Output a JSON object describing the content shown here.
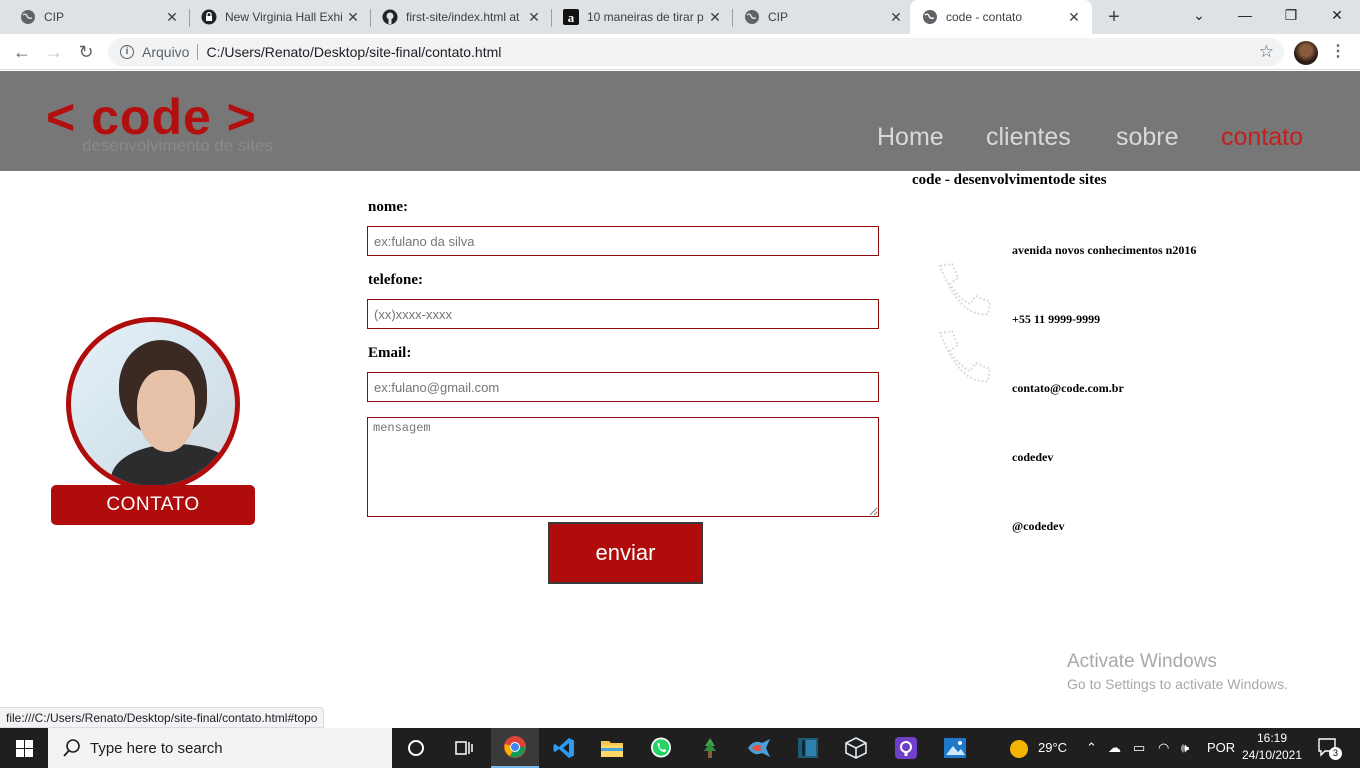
{
  "browser": {
    "tabs": [
      {
        "title": "CIP",
        "icon": "globe-icon"
      },
      {
        "title": "New Virginia Hall Exhi",
        "icon": "lock-icon"
      },
      {
        "title": "first-site/index.html at",
        "icon": "github-icon"
      },
      {
        "title": "10 maneiras de tirar p",
        "icon": "a-logo-icon"
      },
      {
        "title": "CIP",
        "icon": "globe-icon"
      },
      {
        "title": "code - contato",
        "icon": "globe-icon"
      }
    ],
    "new_tab": "+",
    "address": {
      "scheme_label": "Arquivo",
      "url": "C:/Users/Renato/Desktop/site-final/contato.html"
    },
    "status_url": "file:///C:/Users/Renato/Desktop/site-final/contato.html#topo"
  },
  "site": {
    "logo": "< code >",
    "tagline": "desenvolvimento de sites",
    "nav": [
      {
        "label": "Home",
        "active": false
      },
      {
        "label": "clientes",
        "active": false
      },
      {
        "label": "sobre",
        "active": false
      },
      {
        "label": "contato",
        "active": true
      }
    ],
    "contact_banner": "CONTATO",
    "form": {
      "nome_label": "nome:",
      "nome_placeholder": "ex:fulano da silva",
      "telefone_label": "telefone:",
      "telefone_placeholder": "(xx)xxxx-xxxx",
      "email_label": "Email:",
      "email_placeholder": "ex:fulano@gmail.com",
      "mensagem_placeholder": "mensagem",
      "submit_label": "enviar"
    },
    "info": {
      "title": "code - desenvolvimentode sites",
      "address": "avenida novos conhecimentos n2016",
      "phone": "+55 11 9999-9999",
      "email": "contato@code.com.br",
      "social1": "codedev",
      "social2": "@codedev"
    }
  },
  "watermark": {
    "line1": "Activate Windows",
    "line2": "Go to Settings to activate Windows."
  },
  "taskbar": {
    "search_placeholder": "Type here to search",
    "weather": "29°C",
    "language": "POR",
    "time": "16:19",
    "date": "24/10/2021",
    "notifications": "3"
  },
  "colors": {
    "brand_red": "#b00c0c",
    "header_gray": "#777777",
    "nav_inactive": "#d9d9d9"
  }
}
